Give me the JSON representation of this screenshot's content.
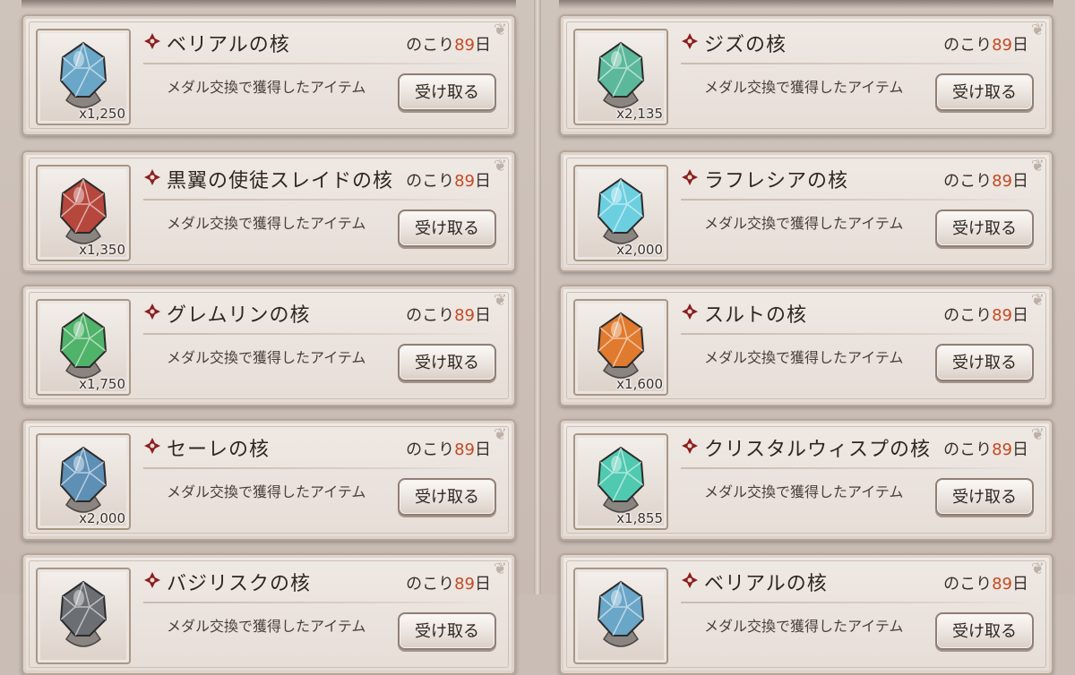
{
  "labels": {
    "description": "メダル交換で獲得したアイテム",
    "remaining_prefix": "のこり",
    "remaining_days": "89",
    "remaining_suffix": "日",
    "claim_button": "受け取る"
  },
  "colors": {
    "remaining_number": "#c24a24",
    "cross_icon": "#8a1f1f",
    "card_background": "#ece5df"
  },
  "left_items": [
    {
      "name": "ベリアルの核",
      "quantity": "x1,250",
      "icon": "belial-core-icon",
      "gem_color": "#6aa6c8"
    },
    {
      "name": "黒翼の使徒スレイドの核",
      "quantity": "x1,350",
      "icon": "slade-core-icon",
      "gem_color": "#b5473c"
    },
    {
      "name": "グレムリンの核",
      "quantity": "x1,750",
      "icon": "gremlin-core-icon",
      "gem_color": "#4fb36a"
    },
    {
      "name": "セーレの核",
      "quantity": "x2,000",
      "icon": "seere-core-icon",
      "gem_color": "#5e8fb5"
    },
    {
      "name": "バジリスクの核",
      "quantity": "",
      "icon": "basilisk-core-icon",
      "gem_color": "#6b6f73"
    }
  ],
  "right_items": [
    {
      "name": "ジズの核",
      "quantity": "x2,135",
      "icon": "ziz-core-icon",
      "gem_color": "#5bb89a"
    },
    {
      "name": "ラフレシアの核",
      "quantity": "x2,000",
      "icon": "rafflesia-core-icon",
      "gem_color": "#6ccfe0"
    },
    {
      "name": "スルトの核",
      "quantity": "x1,600",
      "icon": "surtr-core-icon",
      "gem_color": "#e07a2e"
    },
    {
      "name": "クリスタルウィスプの核",
      "quantity": "x1,855",
      "icon": "crystal-wisp-core-icon",
      "gem_color": "#4fc9b0"
    },
    {
      "name": "ベリアルの核",
      "quantity": "",
      "icon": "belial-core-icon",
      "gem_color": "#6aa6c8"
    }
  ]
}
